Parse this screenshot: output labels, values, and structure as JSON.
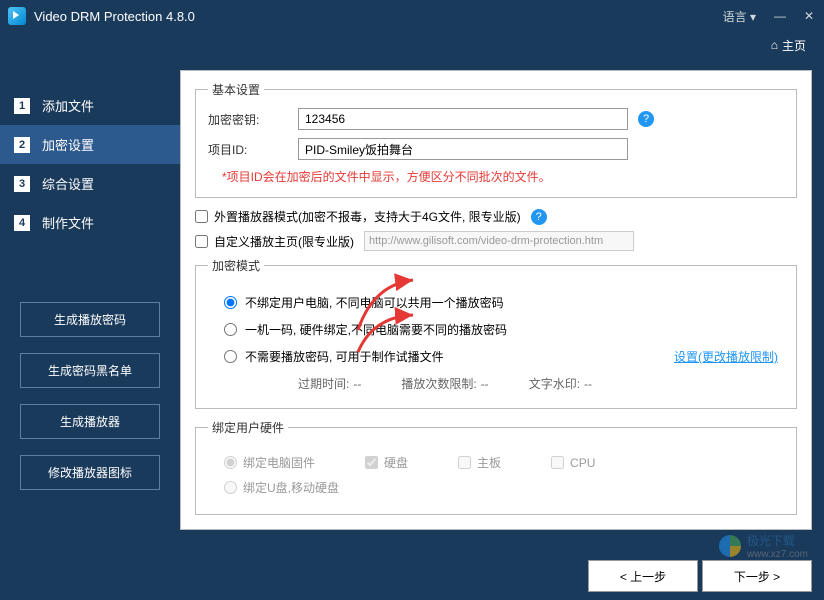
{
  "titlebar": {
    "app_title": "Video DRM Protection 4.8.0",
    "language_label": "语言"
  },
  "home": {
    "label": "主页"
  },
  "sidebar": {
    "steps": [
      {
        "num": "1",
        "label": "添加文件"
      },
      {
        "num": "2",
        "label": "加密设置"
      },
      {
        "num": "3",
        "label": "综合设置"
      },
      {
        "num": "4",
        "label": "制作文件"
      }
    ],
    "buttons": {
      "gen_play_code": "生成播放密码",
      "gen_blacklist": "生成密码黑名单",
      "gen_player": "生成播放器",
      "modify_player_icon": "修改播放器图标"
    }
  },
  "basic": {
    "legend": "基本设置",
    "key_label": "加密密钥:",
    "key_value": "123456",
    "pid_label": "项目ID:",
    "pid_value": "PID-Smiley饭拍舞台",
    "warn_text": "*项目ID会在加密后的文件中显示，方便区分不同批次的文件。"
  },
  "external": {
    "player_label": "外置播放器模式(加密不报毒，支持大于4G文件, 限专业版)",
    "custom_home_label": "自定义播放主页(限专业版)",
    "custom_home_url": "http://www.gilisoft.com/video-drm-protection.htm"
  },
  "mode": {
    "legend": "加密模式",
    "opt1": "不绑定用户电脑, 不同电脑可以共用一个播放密码",
    "opt2": "一机一码, 硬件绑定,不同电脑需要不同的播放密码",
    "opt3": "不需要播放密码, 可用于制作试播文件",
    "settings_link": "设置(更改播放限制)",
    "expire_label": "过期时间:",
    "expire_val": "--",
    "count_label": "播放次数限制:",
    "count_val": "--",
    "watermark_label": "文字水印:",
    "watermark_val": "--"
  },
  "hardware": {
    "legend": "绑定用户硬件",
    "bind_hw": "绑定电脑固件",
    "hdd": "硬盘",
    "mb": "主板",
    "cpu": "CPU",
    "bind_usb": "绑定U盘,移动硬盘"
  },
  "footer": {
    "prev": "< 上一步",
    "next": "下一步 >"
  },
  "watermark": {
    "site": "极光下载",
    "url": "www.xz7.com"
  }
}
